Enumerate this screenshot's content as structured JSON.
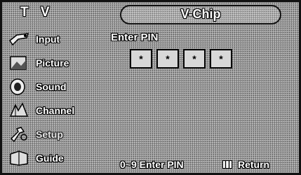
{
  "header": {
    "source_label": "T V",
    "title": "V-Chip"
  },
  "sidebar": {
    "items": [
      {
        "label": "Input",
        "icon": "input-icon",
        "enabled": true
      },
      {
        "label": "Picture",
        "icon": "picture-icon",
        "enabled": true
      },
      {
        "label": "Sound",
        "icon": "sound-icon",
        "enabled": true
      },
      {
        "label": "Channel",
        "icon": "channel-icon",
        "enabled": true
      },
      {
        "label": "Setup",
        "icon": "setup-icon",
        "enabled": false
      },
      {
        "label": "Guide",
        "icon": "guide-icon",
        "enabled": true
      }
    ]
  },
  "main": {
    "prompt": "Enter PIN",
    "pin_digits": [
      "*",
      "*",
      "*",
      "*"
    ]
  },
  "footer": {
    "enter_hint": "0~9 Enter PIN",
    "return_hint": "Return",
    "return_icon": "menu-icon"
  },
  "colors": {
    "background": "#9a9a9a",
    "text": "#ffffff",
    "outline": "#000000",
    "pin_box": "#d8d8d8"
  }
}
